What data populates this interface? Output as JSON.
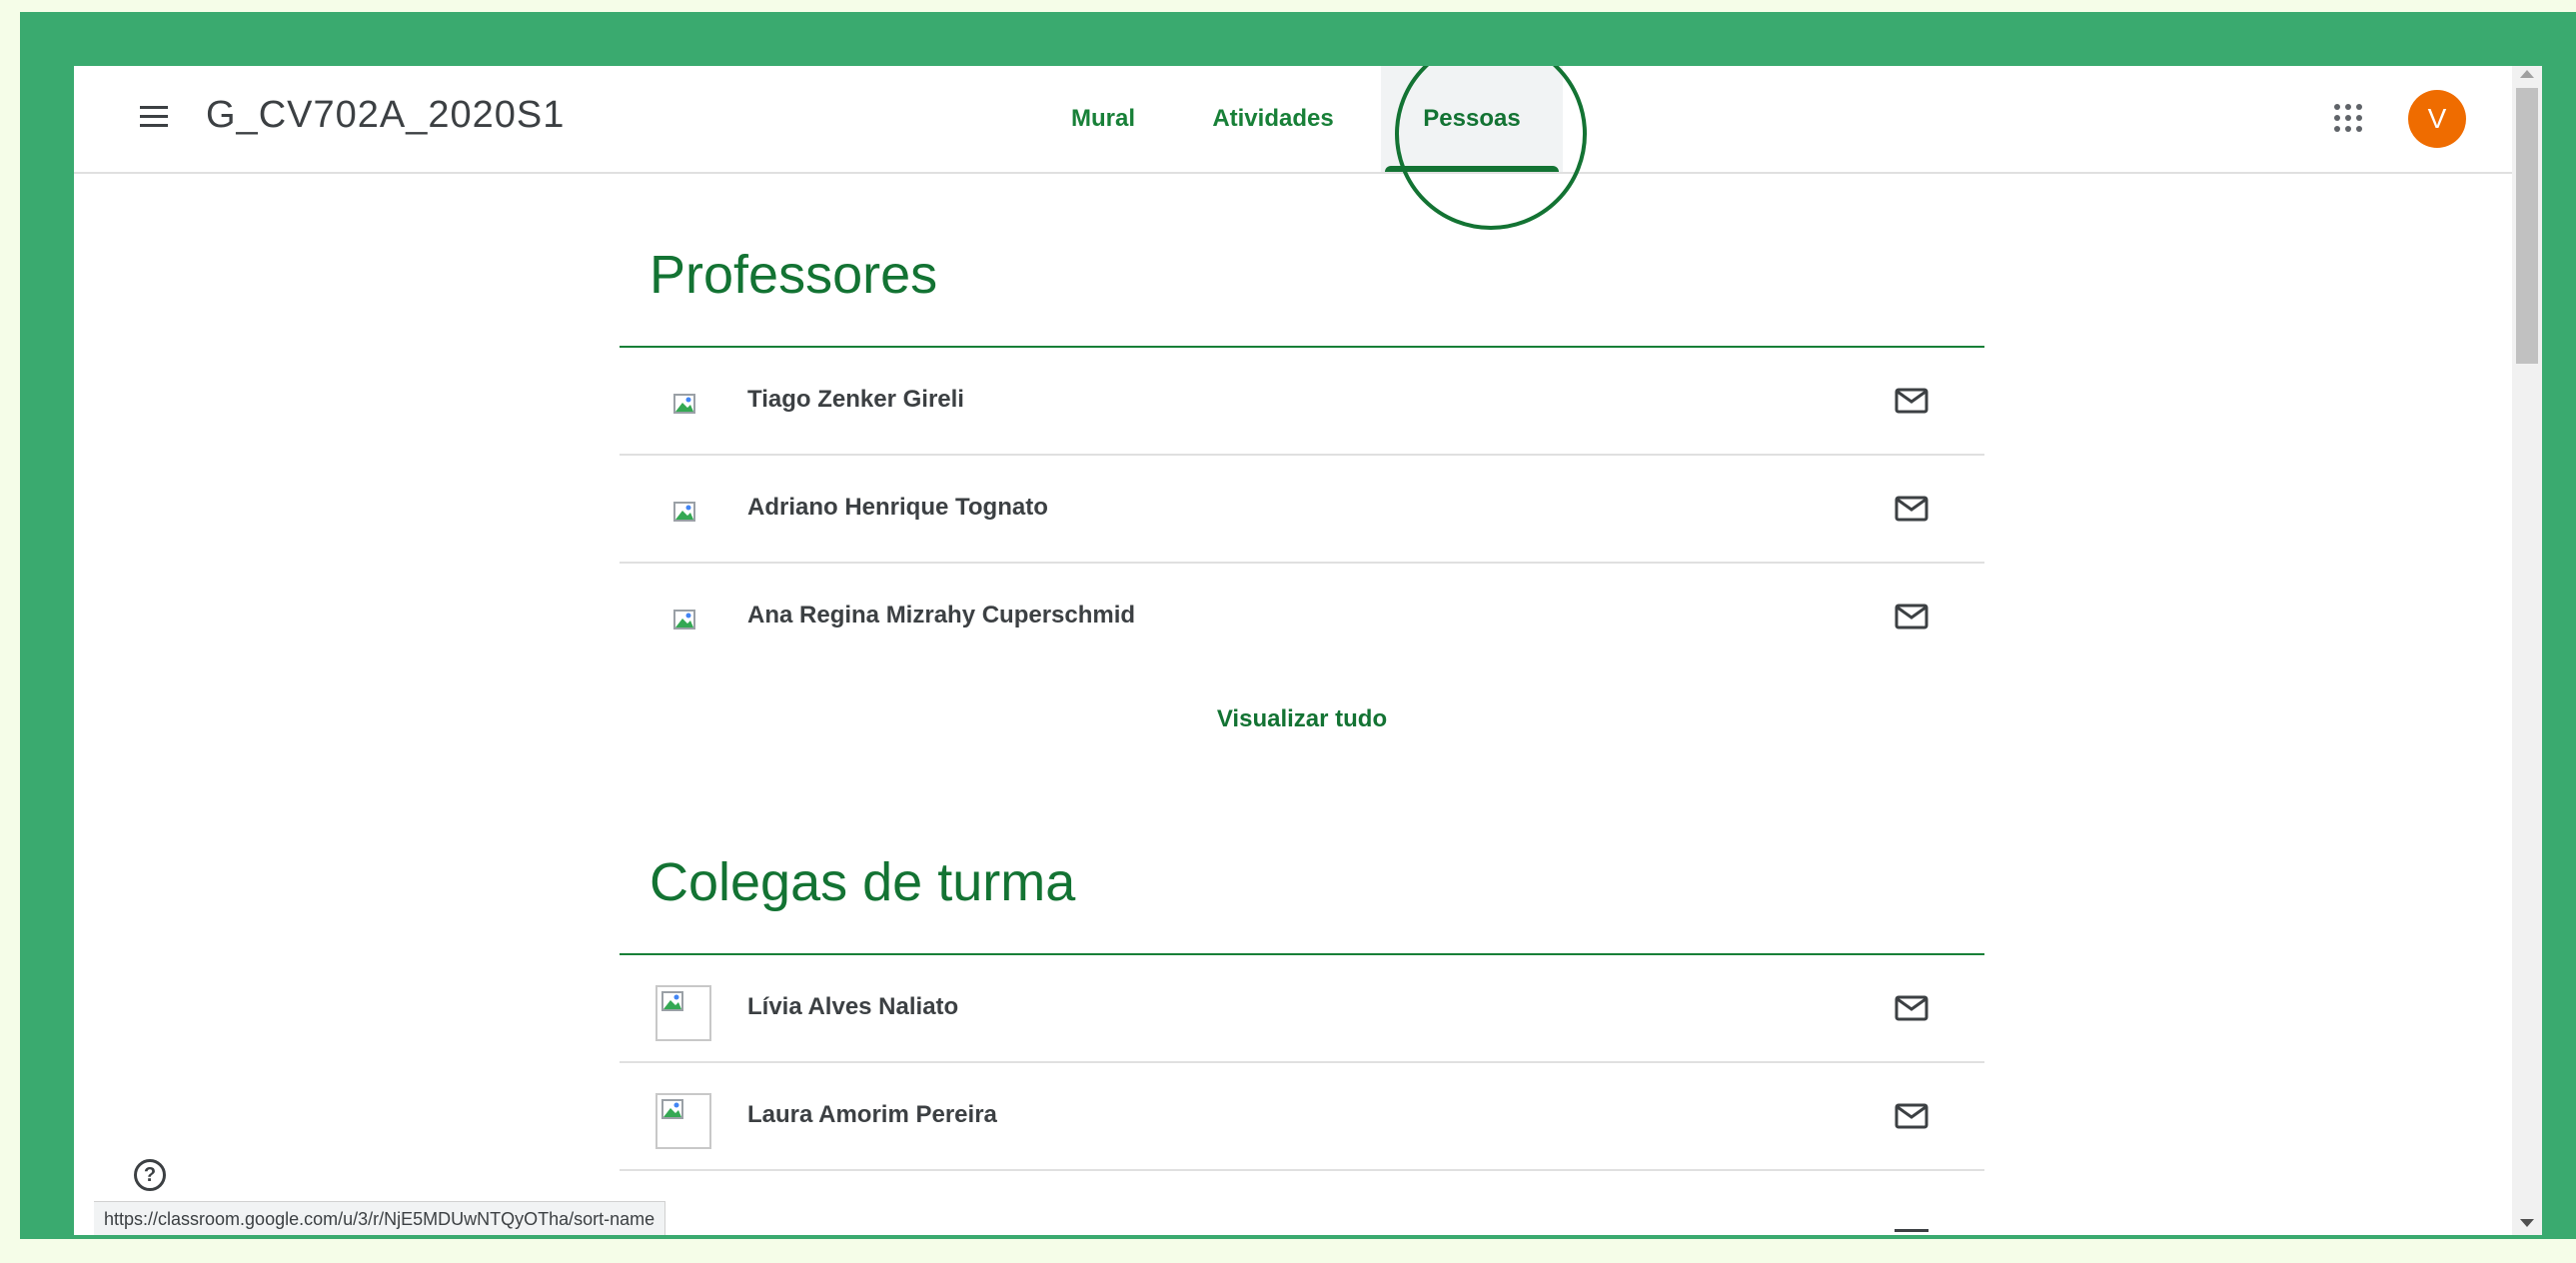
{
  "header": {
    "class_title": "G_CV702A_2020S1",
    "avatar_initial": "V"
  },
  "tabs": [
    {
      "label": "Mural",
      "active": false
    },
    {
      "label": "Atividades",
      "active": false
    },
    {
      "label": "Pessoas",
      "active": true
    }
  ],
  "teachers": {
    "title": "Professores",
    "people": [
      {
        "name": "Tiago Zenker Gireli"
      },
      {
        "name": "Adriano Henrique Tognato"
      },
      {
        "name": "Ana Regina Mizrahy Cuperschmid"
      }
    ],
    "view_all": "Visualizar tudo"
  },
  "classmates": {
    "title": "Colegas de turma",
    "people": [
      {
        "name": "Lívia Alves Naliato"
      },
      {
        "name": "Laura Amorim Pereira"
      }
    ]
  },
  "status_url": "https://classroom.google.com/u/3/r/NjE5MDUwNTQyOTha/sort-name",
  "colors": {
    "frame_green": "#3aaa6f",
    "accent_green": "#137333",
    "avatar_orange": "#ef6c00"
  },
  "icons": [
    "menu-icon",
    "apps-grid-icon",
    "mail-icon",
    "broken-image-icon",
    "help-icon"
  ]
}
